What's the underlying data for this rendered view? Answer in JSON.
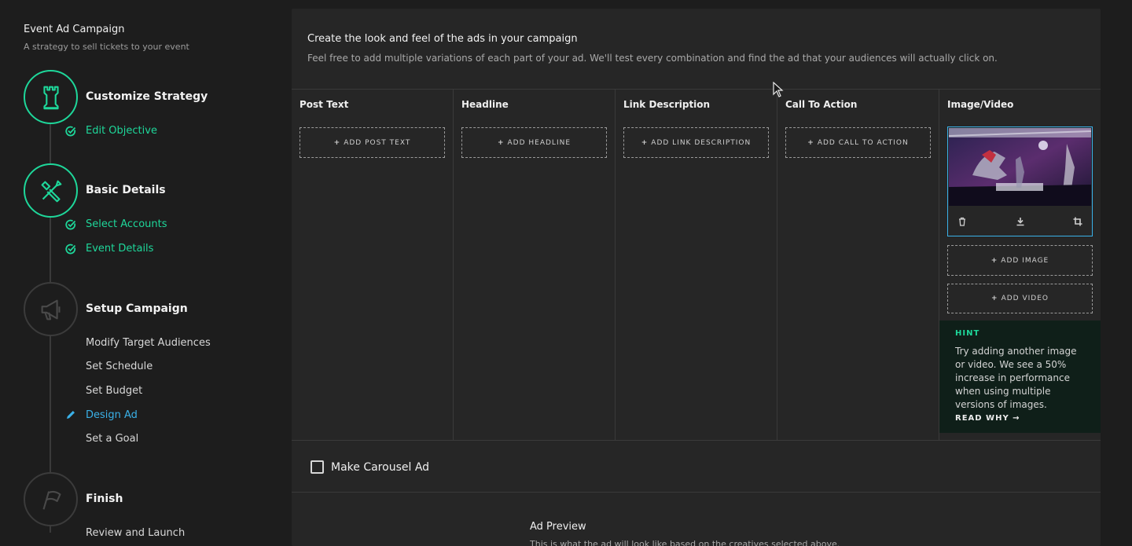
{
  "sidebar": {
    "campaign_title": "Event Ad Campaign",
    "campaign_subtitle": "A strategy to sell tickets to your event",
    "steps": [
      {
        "title": "Customize Strategy",
        "icon": "rook-icon",
        "status": "done",
        "substeps": [
          {
            "label": "Edit Objective",
            "status": "done"
          }
        ]
      },
      {
        "title": "Basic Details",
        "icon": "tools-icon",
        "status": "done",
        "substeps": [
          {
            "label": "Select Accounts",
            "status": "done"
          },
          {
            "label": "Event Details",
            "status": "done"
          }
        ]
      },
      {
        "title": "Setup Campaign",
        "icon": "megaphone-icon",
        "status": "current",
        "substeps": [
          {
            "label": "Modify Target Audiences",
            "status": "pending"
          },
          {
            "label": "Set Schedule",
            "status": "pending"
          },
          {
            "label": "Set Budget",
            "status": "pending"
          },
          {
            "label": "Design Ad",
            "status": "active"
          },
          {
            "label": "Set a Goal",
            "status": "pending"
          }
        ]
      },
      {
        "title": "Finish",
        "icon": "flag-icon",
        "status": "pending",
        "substeps": [
          {
            "label": "Review and Launch",
            "status": "pending"
          }
        ]
      }
    ]
  },
  "main": {
    "title": "Create the look and feel of the ads in your campaign",
    "subtitle": "Feel free to add multiple variations of each part of your ad. We'll test every combination and find the ad that your audiences will actually click on.",
    "columns": [
      {
        "header": "Post Text",
        "button": "ADD POST TEXT"
      },
      {
        "header": "Headline",
        "button": "ADD HEADLINE"
      },
      {
        "header": "Link Description",
        "button": "ADD LINK DESCRIPTION"
      },
      {
        "header": "Call To Action",
        "button": "ADD CALL TO ACTION"
      },
      {
        "header": "Image/Video",
        "buttons": [
          "ADD IMAGE",
          "ADD VIDEO"
        ]
      }
    ],
    "hint": {
      "label": "HINT",
      "text": "Try adding another image or video. We see a 50% increase in performance when using multiple versions of images.",
      "link": "READ WHY →"
    },
    "carousel_label": "Make Carousel Ad",
    "preview_title": "Ad Preview",
    "preview_subtitle": "This is what the ad will look like based on the creatives selected above."
  },
  "colors": {
    "accent_green": "#1ed79a",
    "accent_blue": "#3ab1e8"
  }
}
